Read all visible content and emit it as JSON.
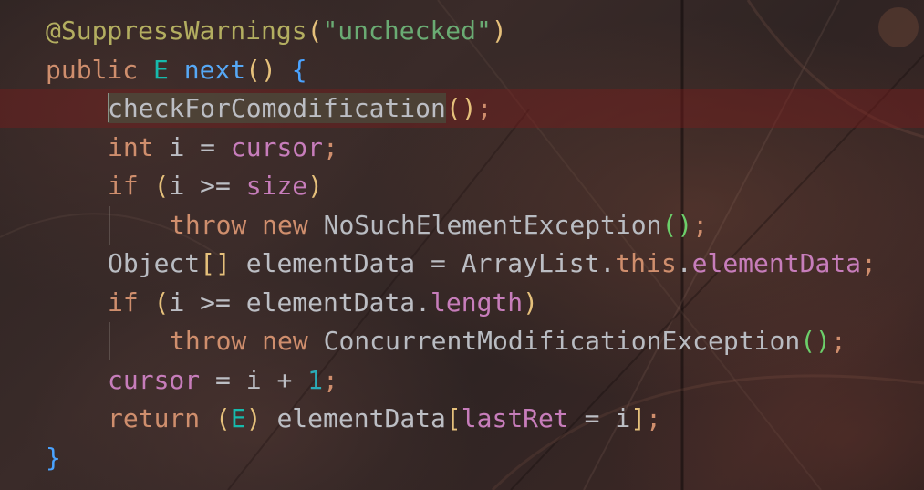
{
  "editor": {
    "lines": [
      {
        "indent": 0,
        "tokens": [
          {
            "t": "@SuppressWarnings",
            "c": "anno"
          },
          {
            "t": "(",
            "c": "paren-y"
          },
          {
            "t": "\"unchecked\"",
            "c": "str"
          },
          {
            "t": ")",
            "c": "paren-y"
          }
        ]
      },
      {
        "indent": 0,
        "tokens": [
          {
            "t": "public ",
            "c": "kw"
          },
          {
            "t": "E ",
            "c": "tparam"
          },
          {
            "t": "next",
            "c": "method"
          },
          {
            "t": "() ",
            "c": "paren-y"
          },
          {
            "t": "{",
            "c": "brace-b"
          }
        ]
      },
      {
        "indent": 1,
        "current": true,
        "tokens": [
          {
            "t": "checkForComodification",
            "c": "plain",
            "hl": true,
            "cursor": true
          },
          {
            "t": "()",
            "c": "paren-y"
          },
          {
            "t": ";",
            "c": "semi"
          }
        ]
      },
      {
        "indent": 1,
        "tokens": [
          {
            "t": "int ",
            "c": "kw"
          },
          {
            "t": "i = ",
            "c": "plain"
          },
          {
            "t": "cursor",
            "c": "field"
          },
          {
            "t": ";",
            "c": "semi"
          }
        ]
      },
      {
        "indent": 1,
        "tokens": [
          {
            "t": "if ",
            "c": "kw"
          },
          {
            "t": "(",
            "c": "paren-y"
          },
          {
            "t": "i >= ",
            "c": "plain"
          },
          {
            "t": "size",
            "c": "field"
          },
          {
            "t": ")",
            "c": "paren-y"
          }
        ]
      },
      {
        "indent": 2,
        "guide": true,
        "tokens": [
          {
            "t": "throw ",
            "c": "kw"
          },
          {
            "t": "new ",
            "c": "kw"
          },
          {
            "t": "NoSuchElementException",
            "c": "type"
          },
          {
            "t": "()",
            "c": "paren-g"
          },
          {
            "t": ";",
            "c": "semi"
          }
        ]
      },
      {
        "indent": 1,
        "tokens": [
          {
            "t": "Object",
            "c": "type"
          },
          {
            "t": "[] ",
            "c": "paren-y"
          },
          {
            "t": "elementData = ArrayList.",
            "c": "plain"
          },
          {
            "t": "this",
            "c": "kw"
          },
          {
            "t": ".",
            "c": "plain"
          },
          {
            "t": "elementData",
            "c": "field"
          },
          {
            "t": ";",
            "c": "semi"
          }
        ]
      },
      {
        "indent": 1,
        "tokens": [
          {
            "t": "if ",
            "c": "kw"
          },
          {
            "t": "(",
            "c": "paren-y"
          },
          {
            "t": "i >= elementData.",
            "c": "plain"
          },
          {
            "t": "length",
            "c": "field"
          },
          {
            "t": ")",
            "c": "paren-y"
          }
        ]
      },
      {
        "indent": 2,
        "guide": true,
        "tokens": [
          {
            "t": "throw ",
            "c": "kw"
          },
          {
            "t": "new ",
            "c": "kw"
          },
          {
            "t": "ConcurrentModificationException",
            "c": "type"
          },
          {
            "t": "()",
            "c": "paren-g"
          },
          {
            "t": ";",
            "c": "semi"
          }
        ]
      },
      {
        "indent": 1,
        "tokens": [
          {
            "t": "cursor",
            "c": "field"
          },
          {
            "t": " = i + ",
            "c": "plain"
          },
          {
            "t": "1",
            "c": "num"
          },
          {
            "t": ";",
            "c": "semi"
          }
        ]
      },
      {
        "indent": 1,
        "tokens": [
          {
            "t": "return ",
            "c": "kw"
          },
          {
            "t": "(",
            "c": "paren-y"
          },
          {
            "t": "E",
            "c": "tparam"
          },
          {
            "t": ") ",
            "c": "paren-y"
          },
          {
            "t": "elementData",
            "c": "plain"
          },
          {
            "t": "[",
            "c": "paren-y"
          },
          {
            "t": "lastRet",
            "c": "field"
          },
          {
            "t": " = i",
            "c": "plain"
          },
          {
            "t": "]",
            "c": "paren-y"
          },
          {
            "t": ";",
            "c": "semi"
          }
        ]
      },
      {
        "indent": 0,
        "tokens": [
          {
            "t": "}",
            "c": "brace-b"
          }
        ]
      }
    ]
  },
  "colors": {
    "keyword": "#cf8e6d",
    "annotation": "#b3ae60",
    "string": "#6aab73",
    "method": "#56a8f5",
    "field": "#c77dbb",
    "number": "#2aacb8",
    "plain": "#bcbec4",
    "current_line": "#7d1c1c"
  }
}
